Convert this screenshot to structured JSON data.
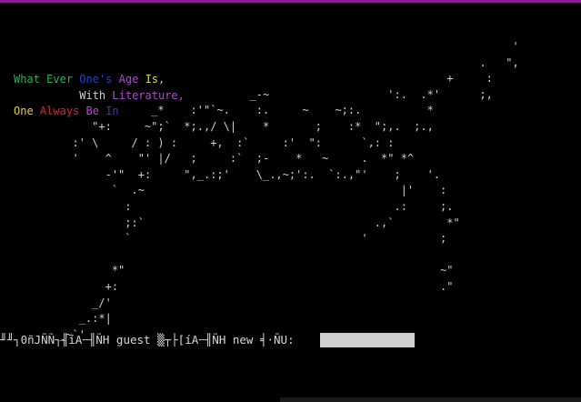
{
  "colors": {
    "title_bar": "#8a1a8e",
    "background": "#000000",
    "input_bg": "#cfcfcf"
  },
  "poem": {
    "line1": [
      {
        "text": "What",
        "color": "g"
      },
      {
        "text": " ",
        "color": "w"
      },
      {
        "text": "Ever",
        "color": "g"
      },
      {
        "text": " ",
        "color": "w"
      },
      {
        "text": "One's",
        "color": "b"
      },
      {
        "text": " ",
        "color": "w"
      },
      {
        "text": "Age",
        "color": "m"
      },
      {
        "text": " ",
        "color": "w"
      },
      {
        "text": "Is,",
        "color": "y"
      }
    ],
    "line2": [
      {
        "text": "          ",
        "color": "w"
      },
      {
        "text": "With",
        "color": "w"
      },
      {
        "text": " ",
        "color": "w"
      },
      {
        "text": "Literature,",
        "color": "m"
      }
    ],
    "line3": [
      {
        "text": "One",
        "color": "y"
      },
      {
        "text": " ",
        "color": "w"
      },
      {
        "text": "Always",
        "color": "r"
      },
      {
        "text": " ",
        "color": "w"
      },
      {
        "text": "Be",
        "color": "m"
      },
      {
        "text": " ",
        "color": "w"
      },
      {
        "text": "In",
        "color": "b"
      }
    ]
  },
  "art_lines": [
    "                                                                              '",
    "                                                                         .   \",",
    "                                                                    +     :",
    "                                      _-~                  ':.  .*'      ;,",
    "                       _*    :'\"`~.    :.     ~    ~;:.          *",
    "              \"+:     ~\";`  *;.,/ \\|    *       ;    :*  \";,.  ;.,",
    "           :' \\     / : ) :     +,  :`     :'  \":      `,: :",
    "           '    ^    \"' |/   ;     :`  ;-    *   ~     .  *\" *^",
    "                -'\"  +:     \",_.:;'    \\_.,~;':.  `:.,\"'    ;    '.",
    "                 `  .~                                       |'    :",
    "                   :                                        .:     ;.",
    "                   ;:`                                   .,`        *\"",
    "                   `                                   '           ;",
    "",
    "                 *\"                                                ~\"",
    "                +:                                                 .\"",
    "              _/'",
    "            _.:*|",
    "         _~`'"
  ],
  "prompt": {
    "text": "╜╜┐0ñJÑÑ┐╢íA╌╢ÑH guest ▒┬├[íA╌╢ÑH new ╡·ÑU: ",
    "input_value": ""
  }
}
